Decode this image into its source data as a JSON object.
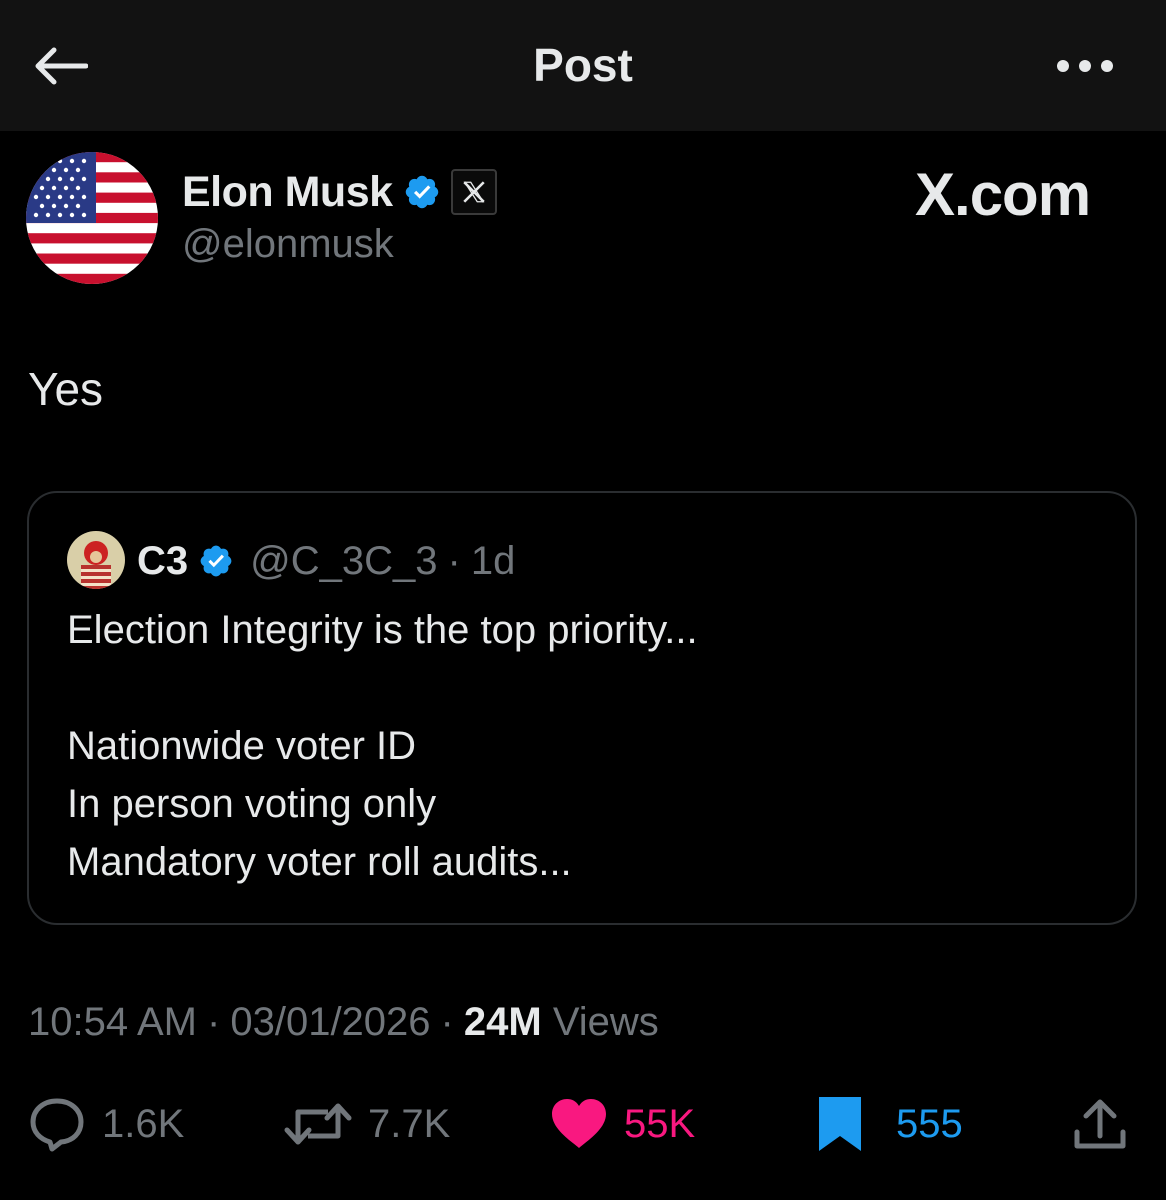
{
  "header": {
    "title": "Post"
  },
  "post": {
    "author_name": "Elon Musk",
    "author_handle": "@elonmusk",
    "brand_label": "X.com",
    "text": "Yes",
    "timestamp_time": "10:54 AM",
    "timestamp_date": "03/01/2026",
    "views_count": "24M",
    "views_label": "Views"
  },
  "quoted": {
    "author_name": "C3",
    "author_handle": "@C_3C_3",
    "age": "1d",
    "text": "Election Integrity is the top priority...\n\nNationwide voter ID\nIn person voting only\nMandatory voter roll audits..."
  },
  "actions": {
    "replies": "1.6K",
    "reposts": "7.7K",
    "likes": "55K",
    "bookmarks": "555"
  },
  "colors": {
    "background": "#000000",
    "header_bg": "#121212",
    "text_primary": "#e7e9ea",
    "text_secondary": "#71767b",
    "verified_blue": "#1d9bf0",
    "like_pink": "#f91880"
  },
  "icons": {
    "back": "arrow-left-icon",
    "more": "ellipsis-icon",
    "verified": "verified-badge-icon",
    "affiliation": "x-logo-icon",
    "reply": "speech-bubble-icon",
    "repost": "repost-arrows-icon",
    "like": "heart-filled-icon",
    "bookmark": "bookmark-filled-icon",
    "share": "share-upload-icon"
  }
}
